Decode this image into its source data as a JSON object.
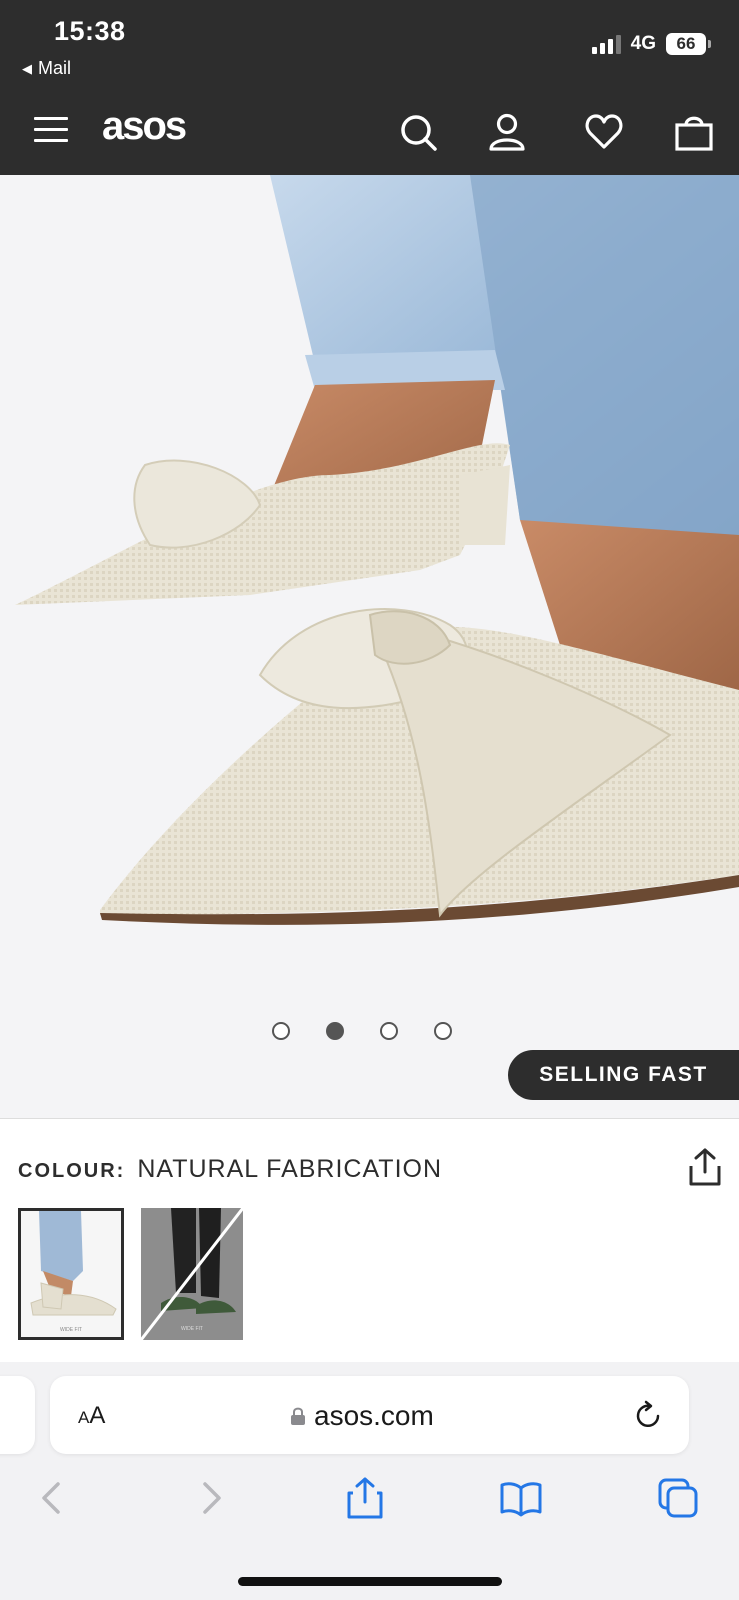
{
  "status_bar": {
    "time": "15:38",
    "back_label": "Mail",
    "network": "4G",
    "battery": "66"
  },
  "header": {
    "logo": "asos",
    "icons": [
      "menu-icon",
      "search-icon",
      "account-icon",
      "wishlist-heart-icon",
      "bag-icon"
    ]
  },
  "gallery": {
    "dots": 4,
    "active_index": 1,
    "badge": "SELLING FAST"
  },
  "colour": {
    "label": "COLOUR:",
    "value": "NATURAL FABRICATION",
    "swatch_caption": "WIDE FIT"
  },
  "safari": {
    "text_size_label_big": "A",
    "text_size_label_small": "A",
    "url": "asos.com",
    "toolbar_icons": [
      "back-icon",
      "forward-icon",
      "share-icon",
      "bookmarks-icon",
      "tabs-icon"
    ]
  },
  "colors": {
    "header_bg": "#2d2d2d",
    "accent_blue": "#2477e6"
  }
}
